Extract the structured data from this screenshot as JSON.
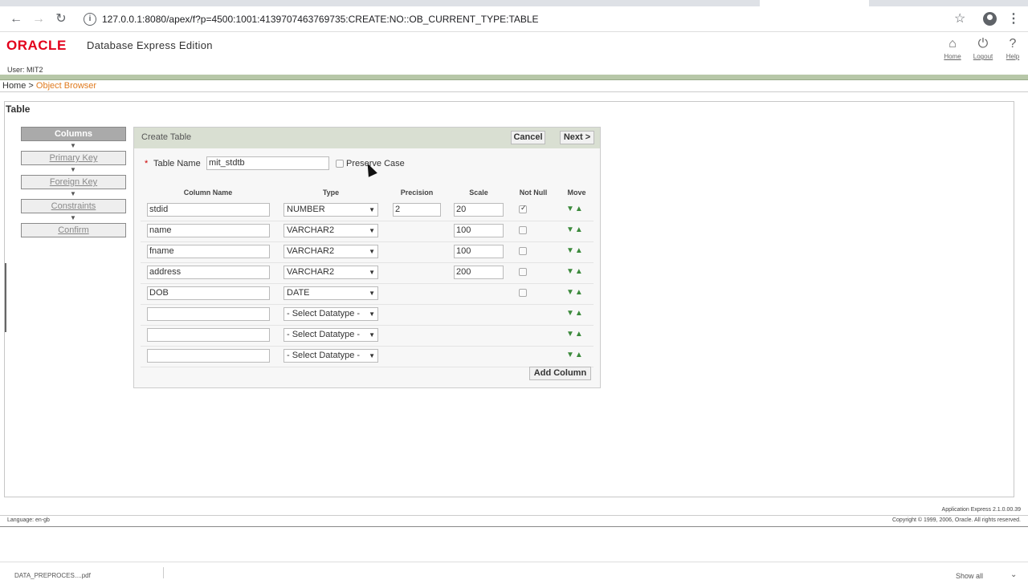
{
  "browser": {
    "url": "127.0.0.1:8080/apex/f?p=4500:1001:4139707463769735:CREATE:NO::OB_CURRENT_TYPE:TABLE",
    "download_file": "DATA_PREPROCES....pdf",
    "show_all": "Show all"
  },
  "header": {
    "logo": "ORACLE",
    "product": "Database Express Edition",
    "user": "User: MIT2",
    "links": [
      {
        "label": "Home",
        "icon": "home-icon"
      },
      {
        "label": "Logout",
        "icon": "power-icon"
      },
      {
        "label": "Help",
        "icon": "help-icon"
      }
    ]
  },
  "breadcrumb": {
    "home": "Home",
    "sep": " > ",
    "current": "Object Browser"
  },
  "region_title": "Table",
  "wizard": {
    "steps": [
      "Columns",
      "Primary Key",
      "Foreign Key",
      "Constraints",
      "Confirm"
    ],
    "active": 0
  },
  "form": {
    "title": "Create Table",
    "cancel": "Cancel",
    "next": "Next >",
    "table_name_label": "Table Name",
    "table_name": "mit_stdtb",
    "preserve_case": "Preserve Case",
    "headers": {
      "column_name": "Column Name",
      "type": "Type",
      "precision": "Precision",
      "scale": "Scale",
      "not_null": "Not Null",
      "move": "Move"
    },
    "rows": [
      {
        "name": "stdid",
        "type": "NUMBER",
        "precision": "2",
        "scale": "20",
        "not_null": true
      },
      {
        "name": "name",
        "type": "VARCHAR2",
        "precision": "",
        "scale": "100",
        "not_null": false
      },
      {
        "name": "fname",
        "type": "VARCHAR2",
        "precision": "",
        "scale": "100",
        "not_null": false
      },
      {
        "name": "address",
        "type": "VARCHAR2",
        "precision": "",
        "scale": "200",
        "not_null": false
      },
      {
        "name": "DOB",
        "type": "DATE",
        "precision": "",
        "scale": "",
        "not_null": false
      },
      {
        "name": "",
        "type": "- Select Datatype -",
        "precision": "",
        "scale": "",
        "not_null": false
      },
      {
        "name": "",
        "type": "- Select Datatype -",
        "precision": "",
        "scale": "",
        "not_null": false
      },
      {
        "name": "",
        "type": "- Select Datatype -",
        "precision": "",
        "scale": "",
        "not_null": false
      }
    ],
    "add_column": "Add Column"
  },
  "footer": {
    "language": "Language: en-gb",
    "version": "Application Express 2.1.0.00.39",
    "copyright": "Copyright © 1999, 2006, Oracle. All rights reserved."
  }
}
